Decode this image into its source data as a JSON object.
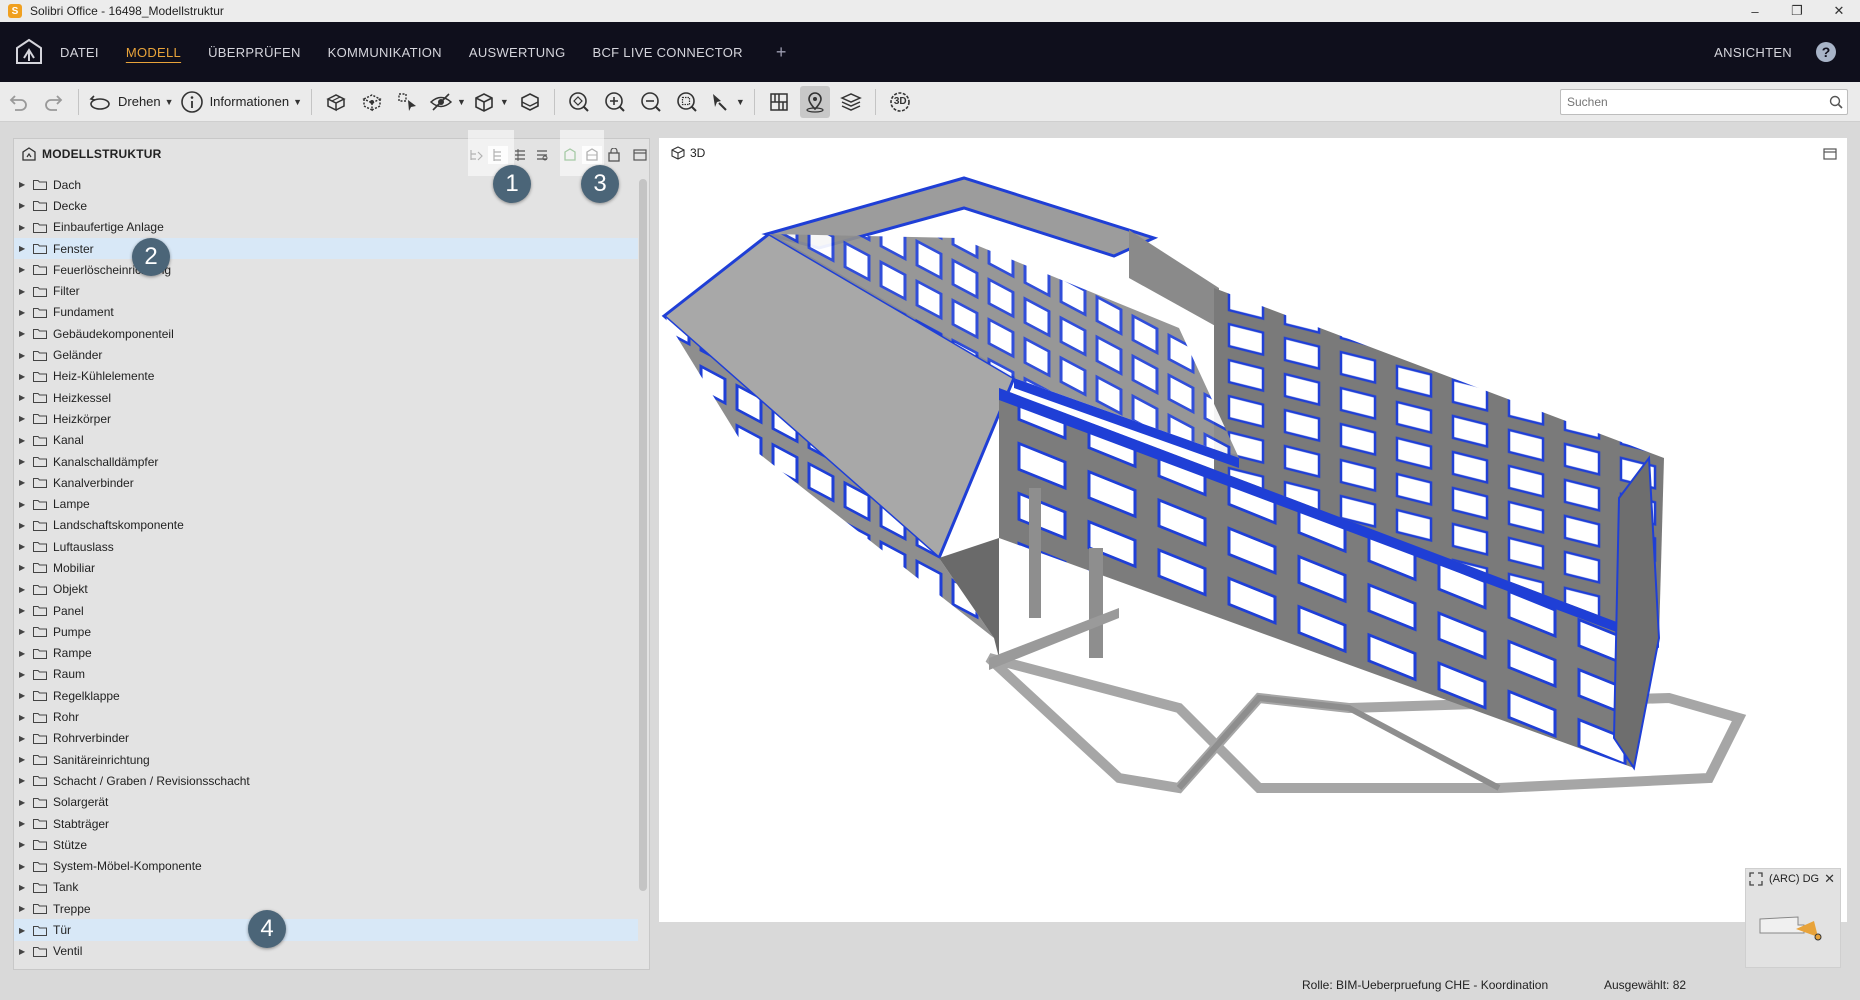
{
  "window": {
    "title": "Solibri Office - 16498_Modellstruktur",
    "app_icon": "S",
    "controls": [
      "–",
      "❐",
      "✕"
    ]
  },
  "menu": {
    "items": [
      "DATEI",
      "MODELL",
      "ÜBERPRÜFEN",
      "KOMMUNIKATION",
      "AUSWERTUNG",
      "BCF LIVE CONNECTOR"
    ],
    "active": "MODELL",
    "plus": "+",
    "right": "ANSICHTEN",
    "help": "?"
  },
  "toolbar": {
    "rotate_label": "Drehen",
    "info_label": "Informationen",
    "search_placeholder": "Suchen",
    "threed_label": "3D"
  },
  "left_panel": {
    "title": "MODELLSTRUKTUR",
    "items": [
      {
        "name": "Dach"
      },
      {
        "name": "Decke"
      },
      {
        "name": "Einbaufertige Anlage"
      },
      {
        "name": "Fenster",
        "highlight": true
      },
      {
        "name": "Feuerlöscheinrichtung"
      },
      {
        "name": "Filter"
      },
      {
        "name": "Fundament"
      },
      {
        "name": "Gebäudekomponenteil"
      },
      {
        "name": "Geländer"
      },
      {
        "name": "Heiz-Kühlelemente"
      },
      {
        "name": "Heizkessel"
      },
      {
        "name": "Heizkörper"
      },
      {
        "name": "Kanal"
      },
      {
        "name": "Kanalschalldämpfer"
      },
      {
        "name": "Kanalverbinder"
      },
      {
        "name": "Lampe"
      },
      {
        "name": "Landschaftskomponente"
      },
      {
        "name": "Luftauslass"
      },
      {
        "name": "Mobiliar"
      },
      {
        "name": "Objekt"
      },
      {
        "name": "Panel"
      },
      {
        "name": "Pumpe"
      },
      {
        "name": "Rampe"
      },
      {
        "name": "Raum"
      },
      {
        "name": "Regelklappe"
      },
      {
        "name": "Rohr"
      },
      {
        "name": "Rohrverbinder"
      },
      {
        "name": "Sanitäreinrichtung"
      },
      {
        "name": "Schacht / Graben / Revisionsschacht"
      },
      {
        "name": "Solargerät"
      },
      {
        "name": "Stabträger"
      },
      {
        "name": "Stütze"
      },
      {
        "name": "System-Möbel-Komponente"
      },
      {
        "name": "Tank"
      },
      {
        "name": "Treppe"
      },
      {
        "name": "Tür",
        "highlight": true
      },
      {
        "name": "Ventil"
      }
    ]
  },
  "markers": [
    "1",
    "2",
    "3",
    "4"
  ],
  "viewport": {
    "label": "3D"
  },
  "minimap": {
    "label": "(ARC) DG",
    "close": "✕"
  },
  "status": {
    "role": "Rolle: BIM-Ueberpruefung CHE - Koordination",
    "selected": "Ausgewählt: 82"
  },
  "colors": {
    "menubar_bg": "#0f0f1c",
    "menu_active": "#e8a33a",
    "selection_blue": "#1f3fd6",
    "row_highlight": "#d8e8f7",
    "marker_bg": "#4b6578"
  }
}
